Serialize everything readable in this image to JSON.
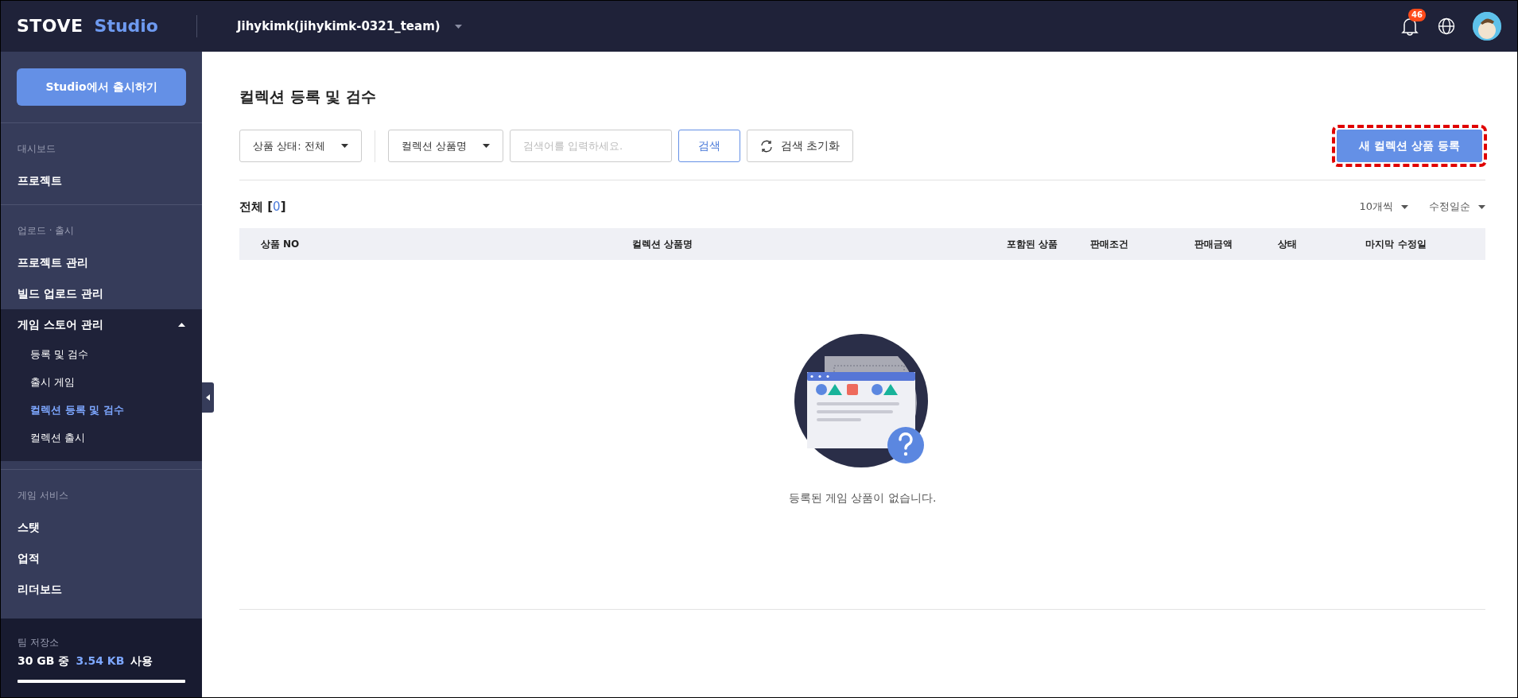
{
  "header": {
    "logo": {
      "brand": "STOVE",
      "product": "Studio"
    },
    "team": "Jihykimk(jihykimk-0321_team)",
    "notifications": "46"
  },
  "sidebar": {
    "launch_button": "Studio에서 출시하기",
    "sections": [
      {
        "label": "대시보드",
        "items": [
          {
            "label": "프로젝트",
            "selected": false
          }
        ]
      },
      {
        "label": "업로드 · 출시",
        "items": [
          {
            "label": "프로젝트 관리",
            "selected": false
          },
          {
            "label": "빌드 업로드 관리",
            "selected": false
          },
          {
            "label": "게임 스토어 관리",
            "selected": false,
            "expanded": true,
            "children": [
              {
                "label": "등록 및 검수",
                "selected": false
              },
              {
                "label": "출시 게임",
                "selected": false
              },
              {
                "label": "컬렉션 등록 및 검수",
                "selected": true
              },
              {
                "label": "컬렉션 출시",
                "selected": false
              }
            ]
          }
        ]
      },
      {
        "label": "게임 서비스",
        "items": [
          {
            "label": "스탯",
            "selected": false
          },
          {
            "label": "업적",
            "selected": false
          },
          {
            "label": "리더보드",
            "selected": false
          }
        ]
      }
    ],
    "storage": {
      "label": "팀 저장소",
      "total": "30 GB 중",
      "used": "3.54 KB",
      "suffix": "사용"
    }
  },
  "page": {
    "title": "컬렉션 등록 및 검수",
    "filters": {
      "status_dropdown": "상품 상태: 전체",
      "field_dropdown": "컬렉션 상품명",
      "search": {
        "placeholder": "검색어를 입력하세요."
      },
      "search_button": "검색",
      "reset_button": "검색 초기화"
    },
    "new_button": {
      "label": "새 컬렉션 상품 등록",
      "highlighted": true
    },
    "total": {
      "label": "전체",
      "count": "0",
      "brackets": [
        "[",
        "]"
      ]
    },
    "page_size": "10개씩",
    "sort": "수정일순",
    "table": {
      "columns": [
        "상품 NO",
        "컬렉션 상품명",
        "포함된 상품",
        "판매조건",
        "판매금액",
        "상태",
        "마지막 수정일"
      ]
    },
    "empty_message": "등록된 게임 상품이 없습니다."
  }
}
